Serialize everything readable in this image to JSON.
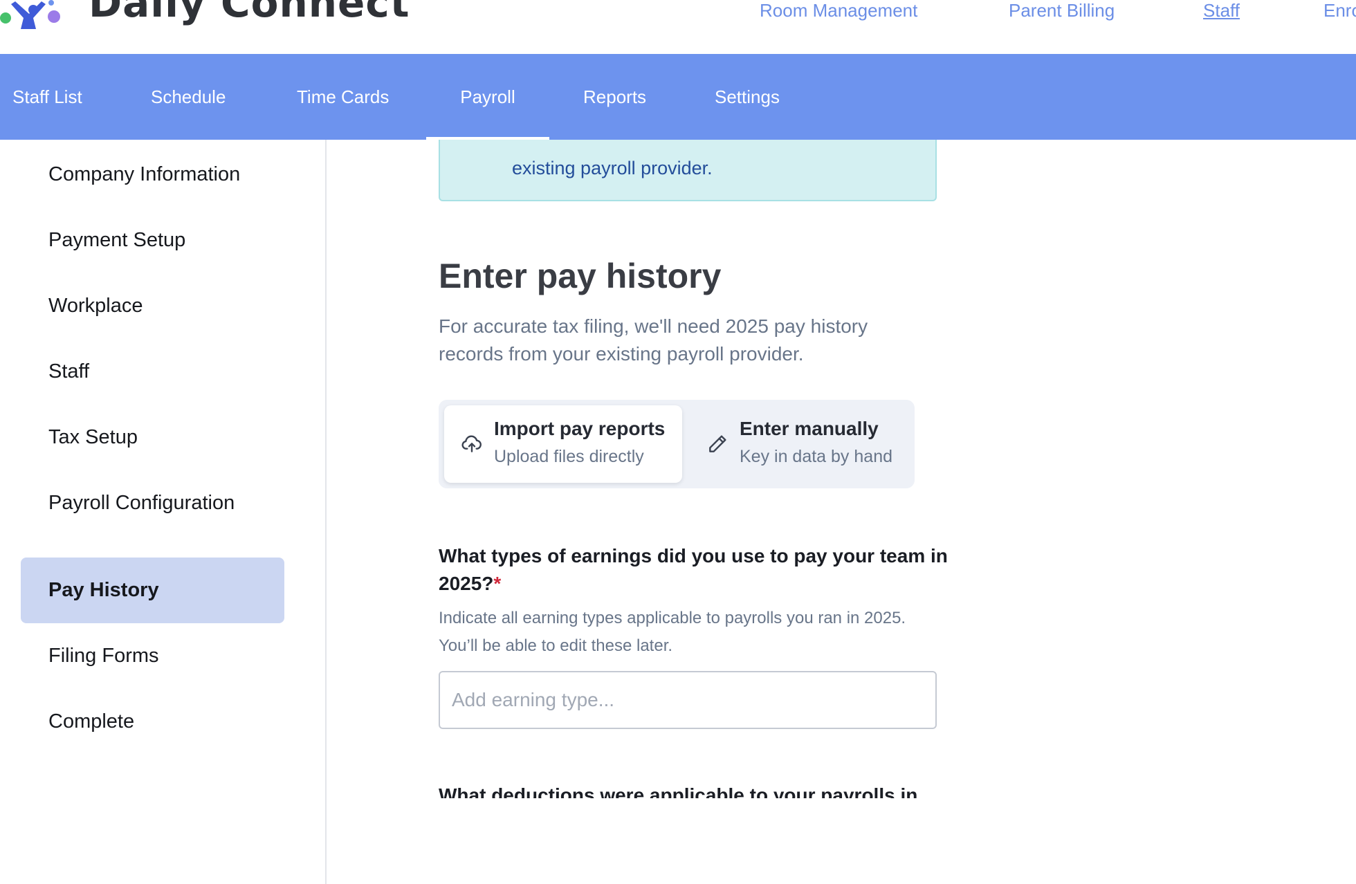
{
  "header": {
    "brand": "Daily Connect",
    "links": [
      {
        "label": "Room Management",
        "active": false
      },
      {
        "label": "Parent Billing",
        "active": false
      },
      {
        "label": "Staff",
        "active": true
      },
      {
        "label": "Enro",
        "active": false
      }
    ]
  },
  "nav": {
    "tabs": [
      {
        "label": "Staff List"
      },
      {
        "label": "Schedule"
      },
      {
        "label": "Time Cards"
      },
      {
        "label": "Payroll",
        "active": true
      },
      {
        "label": "Reports"
      },
      {
        "label": "Settings"
      }
    ],
    "color": "#6d93ee"
  },
  "sidebar": {
    "items": [
      {
        "label": "Company Information"
      },
      {
        "label": "Payment Setup"
      },
      {
        "label": "Workplace"
      },
      {
        "label": "Staff"
      },
      {
        "label": "Tax Setup"
      },
      {
        "label": "Payroll Configuration"
      },
      {
        "label": "Pay History",
        "active": true
      },
      {
        "label": "Filing Forms"
      },
      {
        "label": "Complete"
      }
    ]
  },
  "main": {
    "info_text": "existing payroll provider.",
    "title": "Enter pay history",
    "lead": "For accurate tax filing, we'll need 2025 pay history records from your existing payroll provider.",
    "options": [
      {
        "title": "Import pay reports",
        "subtitle": "Upload files directly",
        "icon": "cloud-upload-icon",
        "selected": true
      },
      {
        "title": "Enter manually",
        "subtitle": "Key in data by hand",
        "icon": "pencil-icon",
        "selected": false
      }
    ],
    "earnings_question": "What types of earnings did you use to pay your team in 2025?",
    "required_mark": "*",
    "earnings_help": "Indicate all earning types applicable to payrolls you ran in 2025. You’ll be able to edit these later.",
    "earnings_placeholder": "Add earning type...",
    "deductions_question": "What deductions were applicable to your payrolls in"
  }
}
